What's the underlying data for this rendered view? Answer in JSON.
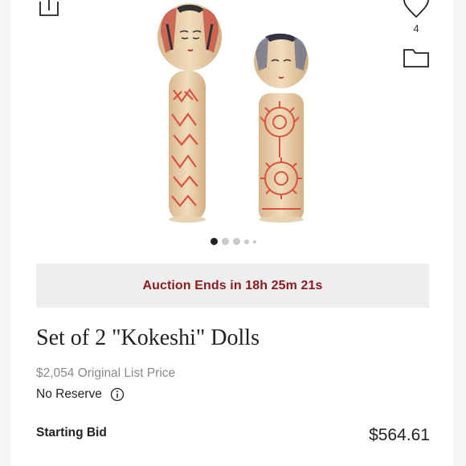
{
  "header": {
    "share_icon": "share-icon",
    "heart_icon": "heart-icon",
    "like_count": "4",
    "folder_icon": "folder-icon"
  },
  "gallery": {
    "image_alt": "Kokeshi dolls",
    "dots": 5,
    "active_index": 0
  },
  "auction": {
    "countdown_text": "Auction Ends in 18h 25m 21s",
    "accent_color": "#8a1c1f",
    "banner_color": "#efeeee"
  },
  "product": {
    "title": "Set of 2 \"Kokeshi\" Dolls",
    "list_price": "$2,054 Original List Price",
    "reserve": "No Reserve",
    "info_icon": "info-icon"
  },
  "bid": {
    "label": "Starting Bid",
    "value": "$564.61"
  }
}
